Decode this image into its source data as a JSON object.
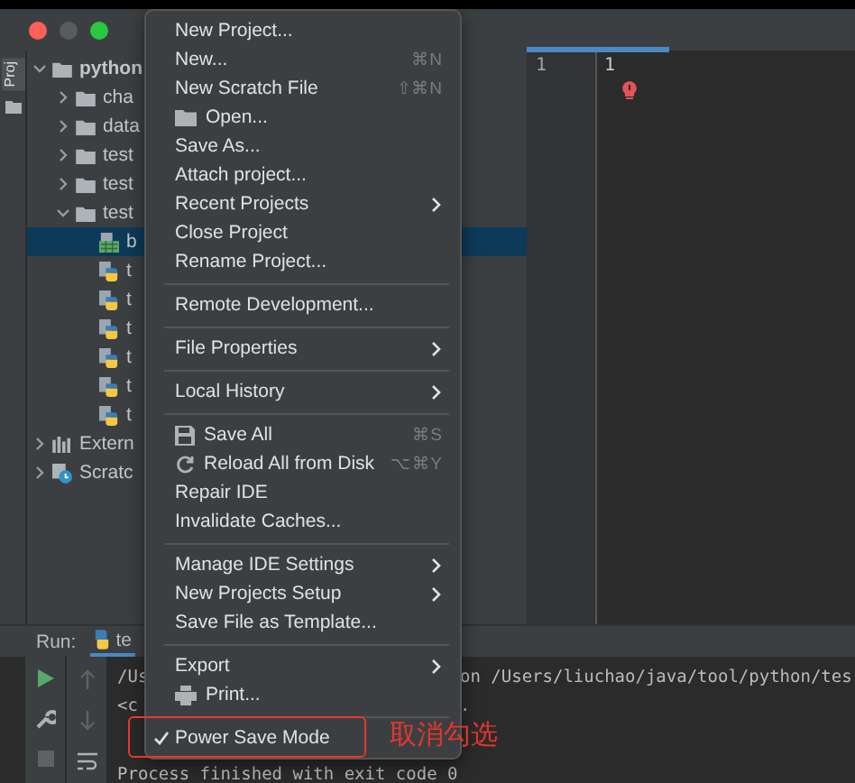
{
  "tool_strip": {
    "label": "Proj"
  },
  "project_tree": [
    {
      "label": "python",
      "kind": "folder",
      "expanded": true,
      "selected": false,
      "children": [
        {
          "label": "cha",
          "kind": "folder",
          "expanded": false,
          "selected": false
        },
        {
          "label": "data",
          "kind": "folder",
          "expanded": false,
          "selected": false
        },
        {
          "label": "test",
          "kind": "folder",
          "expanded": false,
          "selected": false
        },
        {
          "label": "test",
          "kind": "folder",
          "expanded": false,
          "selected": false
        },
        {
          "label": "test",
          "kind": "folder",
          "expanded": true,
          "selected": false,
          "children": [
            {
              "label": "b",
              "kind": "datafile",
              "selected": true
            },
            {
              "label": "t",
              "kind": "pyfile",
              "selected": false
            },
            {
              "label": "t",
              "kind": "pyfile",
              "selected": false
            },
            {
              "label": "t",
              "kind": "pyfile",
              "selected": false
            },
            {
              "label": "t",
              "kind": "pyfile",
              "selected": false
            },
            {
              "label": "t",
              "kind": "pyfile",
              "selected": false
            },
            {
              "label": "t",
              "kind": "pyfile",
              "selected": false
            }
          ]
        }
      ]
    },
    {
      "label": "Extern",
      "kind": "libraries",
      "expanded": false,
      "selected": false
    },
    {
      "label": "Scratc",
      "kind": "scratches",
      "expanded": false,
      "selected": false
    }
  ],
  "editor": {
    "line_numbers": [
      "1"
    ],
    "lines": [
      "1"
    ]
  },
  "run_panel": {
    "title": "Run:",
    "tab": "te",
    "console": [
      {
        "left": "/Us",
        "right": "on /Users/liuchao/java/tool/python/tes"
      },
      {
        "left": "<c",
        "right": "."
      },
      {
        "left": "Process finished with exit code 0"
      }
    ]
  },
  "file_menu": [
    {
      "kind": "item",
      "label": "New Project...",
      "checked": false
    },
    {
      "kind": "item",
      "label": "New...",
      "shortcut": "⌘N",
      "checked": false
    },
    {
      "kind": "item",
      "label": "New Scratch File",
      "shortcut": "⇧⌘N",
      "checked": false
    },
    {
      "kind": "item",
      "label": "Open...",
      "checked": false
    },
    {
      "kind": "item",
      "label": "Save As...",
      "checked": false
    },
    {
      "kind": "item",
      "label": "Attach project...",
      "checked": false
    },
    {
      "kind": "item",
      "label": "Recent Projects",
      "submenu": true,
      "checked": false
    },
    {
      "kind": "item",
      "label": "Close Project",
      "checked": false
    },
    {
      "kind": "item",
      "label": "Rename Project...",
      "checked": false
    },
    {
      "kind": "separator"
    },
    {
      "kind": "item",
      "label": "Remote Development...",
      "checked": false
    },
    {
      "kind": "separator"
    },
    {
      "kind": "item",
      "label": "File Properties",
      "submenu": true,
      "checked": false
    },
    {
      "kind": "separator"
    },
    {
      "kind": "item",
      "label": "Local History",
      "submenu": true,
      "checked": false
    },
    {
      "kind": "separator"
    },
    {
      "kind": "item",
      "label": "Save All",
      "shortcut": "⌘S",
      "checked": false
    },
    {
      "kind": "item",
      "label": "Reload All from Disk",
      "shortcut": "⌥⌘Y",
      "checked": false
    },
    {
      "kind": "item",
      "label": "Repair IDE",
      "checked": false
    },
    {
      "kind": "item",
      "label": "Invalidate Caches...",
      "checked": false
    },
    {
      "kind": "separator"
    },
    {
      "kind": "item",
      "label": "Manage IDE Settings",
      "submenu": true,
      "checked": false
    },
    {
      "kind": "item",
      "label": "New Projects Setup",
      "submenu": true,
      "checked": false
    },
    {
      "kind": "item",
      "label": "Save File as Template...",
      "checked": false
    },
    {
      "kind": "separator"
    },
    {
      "kind": "item",
      "label": "Export",
      "submenu": true,
      "checked": false
    },
    {
      "kind": "item",
      "label": "Print...",
      "checked": false
    },
    {
      "kind": "separator"
    },
    {
      "kind": "item",
      "label": "Power Save Mode",
      "checked": true
    }
  ],
  "annotation": {
    "text": "取消勾选"
  }
}
